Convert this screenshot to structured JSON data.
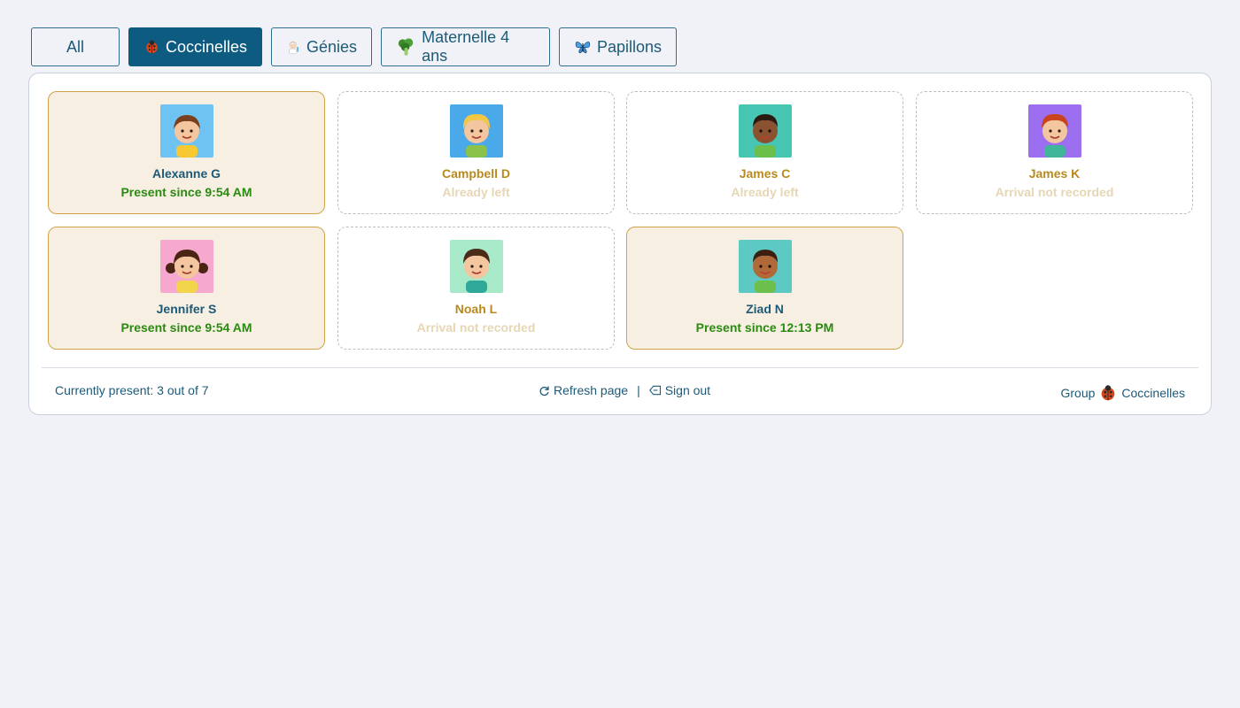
{
  "tabs": [
    {
      "label": "All",
      "icon": "none"
    },
    {
      "label": "Coccinelles",
      "icon": "ladybug-icon"
    },
    {
      "label": "Génies",
      "icon": "scientist-icon"
    },
    {
      "label": "Maternelle 4 ans",
      "icon": "broccoli-icon"
    },
    {
      "label": "Papillons",
      "icon": "butterfly-icon"
    }
  ],
  "active_tab": "Coccinelles",
  "children": [
    {
      "name": "Alexanne G",
      "status": "Present since 9:54 AM",
      "present": true,
      "avatar_bg": "#6ec3f2"
    },
    {
      "name": "Campbell D",
      "status": "Already left",
      "present": false,
      "avatar_bg": "#4aa9e8"
    },
    {
      "name": "James C",
      "status": "Already left",
      "present": false,
      "avatar_bg": "#47c6b3"
    },
    {
      "name": "James K",
      "status": "Arrival not recorded",
      "present": false,
      "avatar_bg": "#9b6ff0"
    },
    {
      "name": "Jennifer S",
      "status": "Present since 9:54 AM",
      "present": true,
      "avatar_bg": "#f7a8cf"
    },
    {
      "name": "Noah L",
      "status": "Arrival not recorded",
      "present": false,
      "avatar_bg": "#a8e9c9"
    },
    {
      "name": "Ziad N",
      "status": "Present since 12:13 PM",
      "present": true,
      "avatar_bg": "#5cc9c4"
    }
  ],
  "footer": {
    "present_count": "Currently present: 3 out of 7",
    "refresh_label": "Refresh page",
    "separator": "|",
    "signout_label": "Sign out",
    "group_prefix": "Group",
    "group_name": "Coccinelles"
  },
  "colors": {
    "accent": "#0d5b81",
    "present_bg": "#f7efe2",
    "present_border": "#d0a34b",
    "present_status": "#2a8a12",
    "absent_name": "#b88a1e",
    "absent_status": "#e6d6b4"
  }
}
